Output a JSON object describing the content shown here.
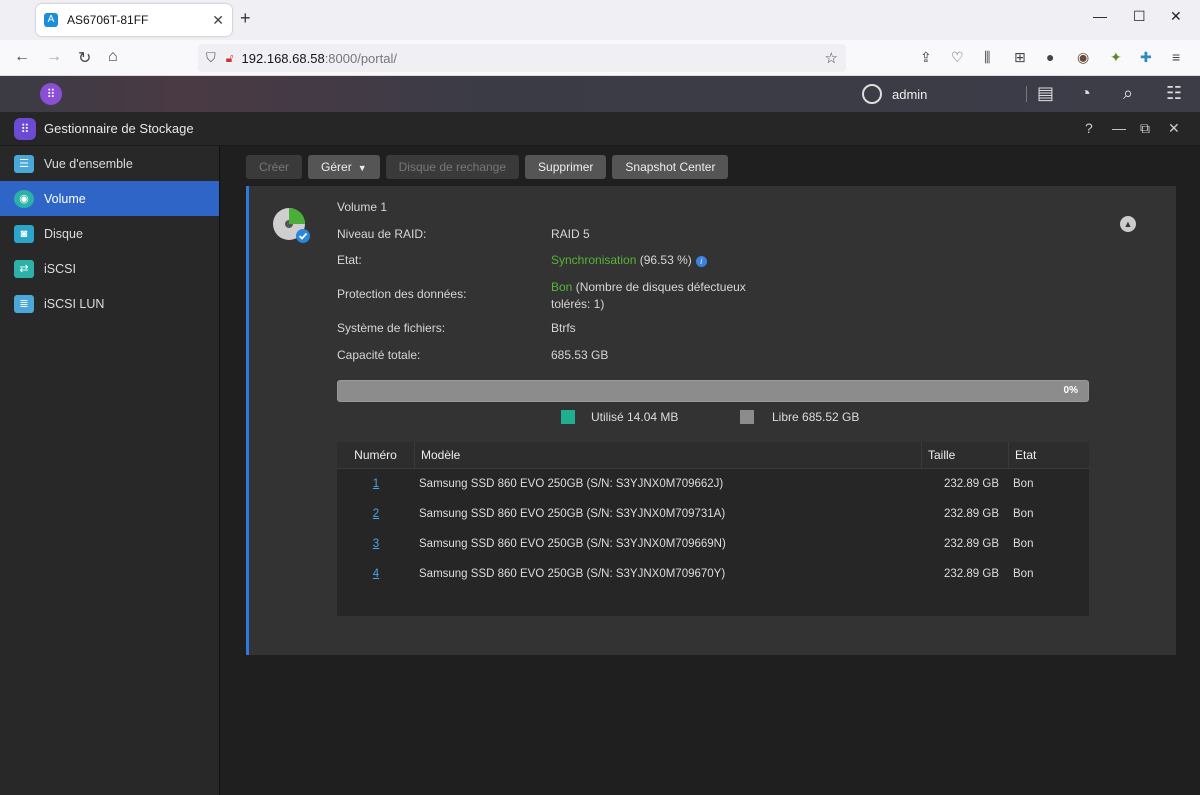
{
  "browser": {
    "tab_title": "AS6706T-81FF",
    "url_host": "192.168.68.58",
    "url_path": ":8000/portal/"
  },
  "adm": {
    "username": "admin"
  },
  "app": {
    "title": "Gestionnaire de Stockage"
  },
  "sidebar": {
    "items": [
      {
        "label": "Vue d'ensemble",
        "icon": "overview-icon",
        "color": "#4aa8d8"
      },
      {
        "label": "Volume",
        "icon": "volume-icon",
        "color": "#2bb1a8"
      },
      {
        "label": "Disque",
        "icon": "disk-icon",
        "color": "#2ba5c8"
      },
      {
        "label": "iSCSI",
        "icon": "iscsi-icon",
        "color": "#2bb1a8"
      },
      {
        "label": "iSCSI LUN",
        "icon": "iscsi-lun-icon",
        "color": "#4aa8d8"
      }
    ],
    "active_index": 1
  },
  "toolbar": {
    "create": "Créer",
    "manage": "Gérer",
    "spare": "Disque de rechange",
    "delete": "Supprimer",
    "snapshot": "Snapshot Center"
  },
  "volume": {
    "name": "Volume 1",
    "labels": {
      "raid": "Niveau de RAID:",
      "state": "Etat:",
      "protection": "Protection des données:",
      "fs": "Système de fichiers:",
      "capacity": "Capacité totale:"
    },
    "raid": "RAID 5",
    "state_status": "Synchronisation",
    "state_pct": " (96.53 %)",
    "protection_status": "Bon",
    "protection_detail_1": " (Nombre de disques défectueux",
    "protection_detail_2": "tolérés: 1)",
    "fs": "Btrfs",
    "capacity": "685.53 GB",
    "usage_percent_label": "0%",
    "usage_fraction": 0.0,
    "used_label": "Utilisé 14.04 MB",
    "free_label": "Libre 685.52 GB",
    "used_color": "#1fae8e",
    "free_color": "#8c8c8c"
  },
  "disks": {
    "headers": [
      "Numéro",
      "Modèle",
      "Taille",
      "Etat"
    ],
    "rows": [
      {
        "num": "1",
        "model": "Samsung SSD 860 EVO 250GB (S/N: S3YJNX0M709662J)",
        "size": "232.89 GB",
        "state": "Bon"
      },
      {
        "num": "2",
        "model": "Samsung SSD 860 EVO 250GB (S/N: S3YJNX0M709731A)",
        "size": "232.89 GB",
        "state": "Bon"
      },
      {
        "num": "3",
        "model": "Samsung SSD 860 EVO 250GB (S/N: S3YJNX0M709669N)",
        "size": "232.89 GB",
        "state": "Bon"
      },
      {
        "num": "4",
        "model": "Samsung SSD 860 EVO 250GB (S/N: S3YJNX0M709670Y)",
        "size": "232.89 GB",
        "state": "Bon"
      }
    ]
  }
}
